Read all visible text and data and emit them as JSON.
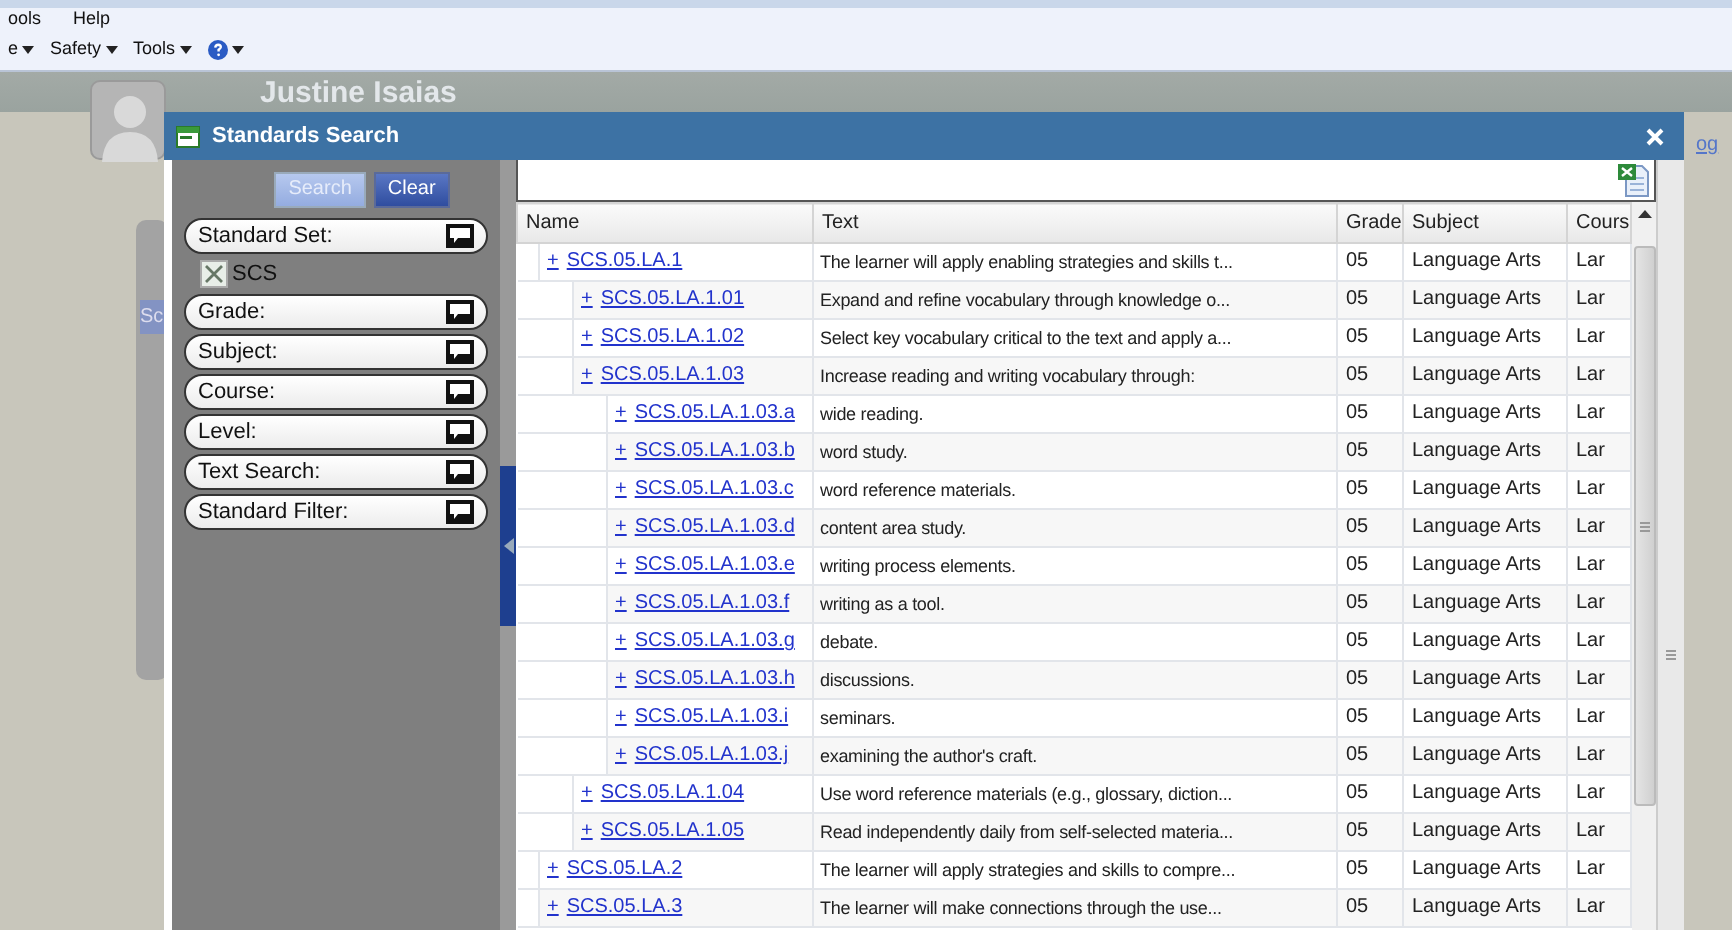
{
  "browser": {
    "menu": [
      "ools",
      "Help"
    ],
    "commands": [
      {
        "kind": "text",
        "label": "e"
      },
      {
        "kind": "text",
        "label": "Safety"
      },
      {
        "kind": "text",
        "label": "Tools"
      },
      {
        "kind": "help"
      }
    ]
  },
  "page": {
    "user_name": "Justine Isaias",
    "side_tab": "Sc",
    "link": "og"
  },
  "dialog": {
    "title": "Standards Search",
    "buttons": [
      {
        "label": "Search",
        "disabled": true
      },
      {
        "label": "Clear",
        "disabled": false
      }
    ],
    "filters": [
      {
        "label": "Standard Set:",
        "tags": [
          "SCS"
        ]
      },
      {
        "label": "Grade:"
      },
      {
        "label": "Subject:"
      },
      {
        "label": "Course:"
      },
      {
        "label": "Level:"
      },
      {
        "label": "Text Search:"
      },
      {
        "label": "Standard Filter:"
      }
    ],
    "table": {
      "columns": [
        "Name",
        "Text",
        "Grade",
        "Subject",
        "Cours"
      ],
      "rows": [
        {
          "toggle": "+",
          "name": "SCS.05.LA.1",
          "text": "The learner will apply enabling strategies and skills t...",
          "grade": "05",
          "subject": "Language Arts",
          "course": "Lar",
          "children": [
            {
              "toggle": "+",
              "name": "SCS.05.LA.1.01",
              "text": "Expand and refine vocabulary through knowledge o...",
              "grade": "05",
              "subject": "Language Arts",
              "course": "Lar"
            },
            {
              "toggle": "+",
              "name": "SCS.05.LA.1.02",
              "text": "Select key vocabulary critical to the text and apply a...",
              "grade": "05",
              "subject": "Language Arts",
              "course": "Lar"
            },
            {
              "toggle": "+",
              "name": "SCS.05.LA.1.03",
              "text": "Increase reading and writing vocabulary through:",
              "grade": "05",
              "subject": "Language Arts",
              "course": "Lar",
              "children": [
                {
                  "toggle": "+",
                  "name": "SCS.05.LA.1.03.a",
                  "text": "wide reading.",
                  "grade": "05",
                  "subject": "Language Arts",
                  "course": "Lar"
                },
                {
                  "toggle": "+",
                  "name": "SCS.05.LA.1.03.b",
                  "text": "word study.",
                  "grade": "05",
                  "subject": "Language Arts",
                  "course": "Lar"
                },
                {
                  "toggle": "+",
                  "name": "SCS.05.LA.1.03.c",
                  "text": "word reference materials.",
                  "grade": "05",
                  "subject": "Language Arts",
                  "course": "Lar"
                },
                {
                  "toggle": "+",
                  "name": "SCS.05.LA.1.03.d",
                  "text": "content area study.",
                  "grade": "05",
                  "subject": "Language Arts",
                  "course": "Lar"
                },
                {
                  "toggle": "+",
                  "name": "SCS.05.LA.1.03.e",
                  "text": "writing process elements.",
                  "grade": "05",
                  "subject": "Language Arts",
                  "course": "Lar"
                },
                {
                  "toggle": "+",
                  "name": "SCS.05.LA.1.03.f",
                  "text": "writing as a tool.",
                  "grade": "05",
                  "subject": "Language Arts",
                  "course": "Lar"
                },
                {
                  "toggle": "+",
                  "name": "SCS.05.LA.1.03.g",
                  "text": "debate.",
                  "grade": "05",
                  "subject": "Language Arts",
                  "course": "Lar"
                },
                {
                  "toggle": "+",
                  "name": "SCS.05.LA.1.03.h",
                  "text": "discussions.",
                  "grade": "05",
                  "subject": "Language Arts",
                  "course": "Lar"
                },
                {
                  "toggle": "+",
                  "name": "SCS.05.LA.1.03.i",
                  "text": "seminars.",
                  "grade": "05",
                  "subject": "Language Arts",
                  "course": "Lar"
                },
                {
                  "toggle": "+",
                  "name": "SCS.05.LA.1.03.j",
                  "text": "examining the author's craft.",
                  "grade": "05",
                  "subject": "Language Arts",
                  "course": "Lar"
                }
              ]
            },
            {
              "toggle": "+",
              "name": "SCS.05.LA.1.04",
              "text": "Use word reference materials (e.g., glossary, diction...",
              "grade": "05",
              "subject": "Language Arts",
              "course": "Lar"
            },
            {
              "toggle": "+",
              "name": "SCS.05.LA.1.05",
              "text": "Read independently daily from self-selected materia...",
              "grade": "05",
              "subject": "Language Arts",
              "course": "Lar"
            }
          ]
        },
        {
          "toggle": "+",
          "name": "SCS.05.LA.2",
          "text": "The learner will apply strategies and skills to compre...",
          "grade": "05",
          "subject": "Language Arts",
          "course": "Lar"
        },
        {
          "toggle": "+",
          "name": "SCS.05.LA.3",
          "text": "The learner will make connections through the use...",
          "grade": "05",
          "subject": "Language Arts",
          "course": "Lar"
        }
      ]
    }
  }
}
